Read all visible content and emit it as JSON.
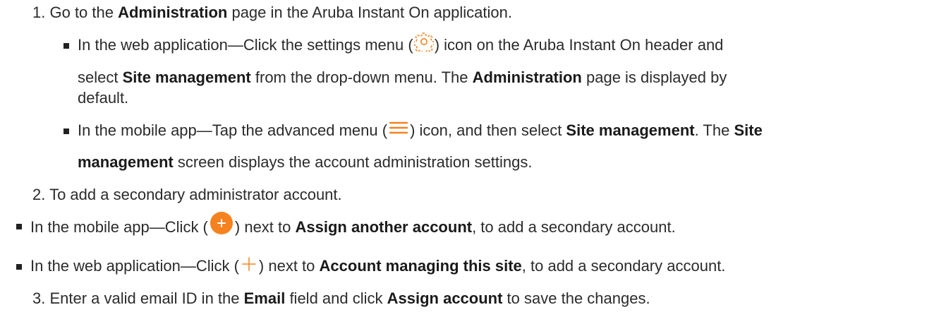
{
  "steps": [
    {
      "number": "1.",
      "text_a": "Go to the ",
      "bold_a": "Administration",
      "text_b": " page in the Aruba Instant On application."
    },
    {
      "number": "2.",
      "text_a": "To add a secondary administrator account."
    },
    {
      "number": "3.",
      "text_a": "Enter a valid email ID in the ",
      "bold_a": "Email",
      "text_b": " field and click ",
      "bold_b": "Assign account",
      "text_c": " to save the changes."
    }
  ],
  "sub1": {
    "l1_a": "In the web application—Click the settings menu (",
    "l1_b": ") icon on the Aruba Instant On header and",
    "l2_a": "select ",
    "l2_b": "Site management",
    "l2_c": " from the drop-down menu. The ",
    "l2_d": "Administration",
    "l2_e": " page is displayed by",
    "l3": "default."
  },
  "sub2": {
    "l1_a": "In the mobile app—Tap the advanced menu (",
    "l1_b": ") icon, and then select ",
    "l1_c": "Site management",
    "l1_d": ". The ",
    "l1_e": "Site",
    "l2_a": "management",
    "l2_b": " screen displays the account administration settings."
  },
  "bullets": {
    "mobile_a": "In the mobile app—Click (",
    "mobile_b": ") next to ",
    "mobile_c": "Assign another account",
    "mobile_d": ", to add a secondary account.",
    "web_a": "In the web application—Click (",
    "web_b": ") next to ",
    "web_c": "Account managing this site",
    "web_d": ", to add a secondary account."
  },
  "icons": {
    "settings": "gear-icon",
    "advanced_menu": "hamburger-menu-icon",
    "add_button": "plus-circle-icon",
    "add": "plus-icon"
  },
  "colors": {
    "accent": "#f5821f",
    "text": "#2b2b2b"
  }
}
